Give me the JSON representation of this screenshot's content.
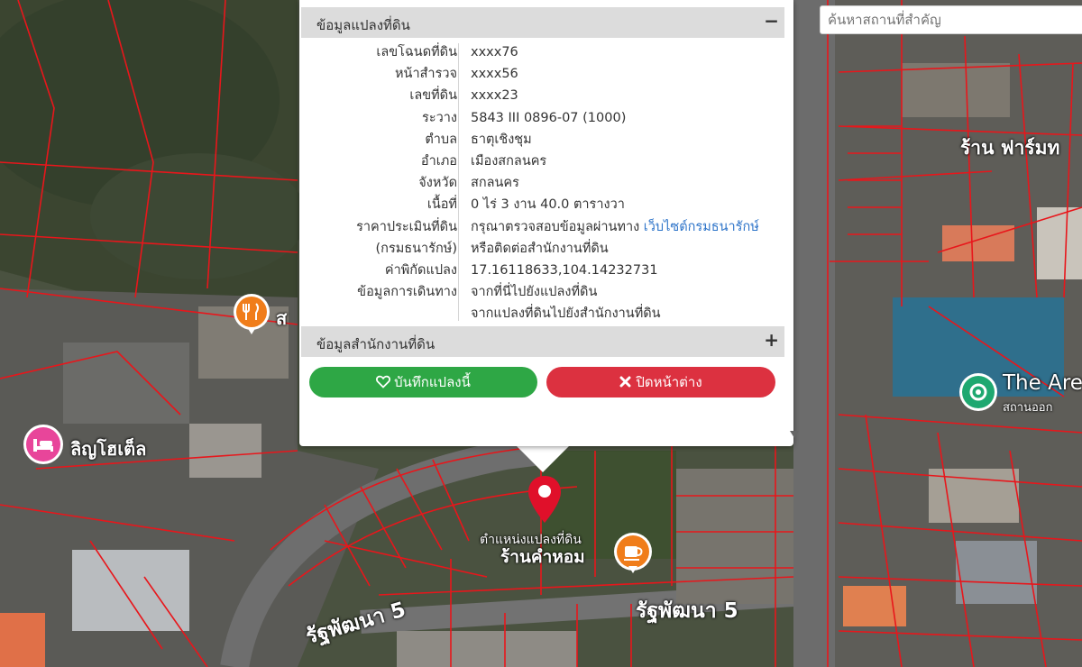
{
  "search": {
    "placeholder": "ค้นหาสถานที่สำคัญ"
  },
  "popup": {
    "parcel_section_title": "ข้อมูลแปลงที่ดิน",
    "parcel_toggle": "−",
    "rows": [
      {
        "label": "เลขโฉนดที่ดิน",
        "value": "xxxx76"
      },
      {
        "label": "หน้าสำรวจ",
        "value": "xxxx56"
      },
      {
        "label": "เลขที่ดิน",
        "value": "xxxx23"
      },
      {
        "label": "ระวาง",
        "value": "5843 III 0896-07 (1000)"
      },
      {
        "label": "ตำบล",
        "value": "ธาตุเชิงชุม"
      },
      {
        "label": "อำเภอ",
        "value": "เมืองสกลนคร"
      },
      {
        "label": "จังหวัด",
        "value": "สกลนคร"
      },
      {
        "label": "เนื้อที่",
        "value": "0 ไร่ 3 งาน 40.0 ตารางวา"
      }
    ],
    "price_label_1": "ราคาประเมินที่ดิน",
    "price_label_2": "(กรมธนารักษ์)",
    "price_text": "กรุณาตรวจสอบข้อมูลผ่านทาง",
    "price_link": "เว็บไซต์กรมธนารักษ์",
    "price_text_2": "หรือติดต่อสำนักงานที่ดิน",
    "coord_label": "ค่าพิกัดแปลง",
    "coord_value": "17.16118633,104.14232731",
    "travel_label": "ข้อมูลการเดินทาง",
    "travel_link_1": "จากที่นี่ไปยังแปลงที่ดิน",
    "travel_link_2": "จากแปลงที่ดินไปยังสำนักงานที่ดิน",
    "office_section_title": "ข้อมูลสำนักงานที่ดิน",
    "office_toggle": "+",
    "save_button": "บันทึกแปลงนี้",
    "close_button": "ปิดหน้าต่าง"
  },
  "map_labels": {
    "pin_label": "ตำแหน่งแปลงที่ดิน",
    "cafe": "ร้านคำหอม",
    "hotel": "ลิญโฮเต็ล",
    "road_right": "รัฐพัฒนา 5",
    "road_left": "รัฐพัฒนา 5",
    "shop_right": "ร้าน ฟาร์มท",
    "the_area": "The Are",
    "the_area_sub": "สถานออก",
    "restaurant_partial": "ส"
  },
  "colors": {
    "parcel_line": "#e8161b",
    "save_green": "#2ea745",
    "close_red": "#dc3140",
    "link_blue": "#2e74c9",
    "pin_red": "#e0102a",
    "poi_orange": "#f07d1a",
    "poi_pink": "#e8459a",
    "poi_green": "#1ea870"
  },
  "icons": [
    "heart-icon",
    "close-icon",
    "map-pin-icon",
    "restaurant-icon",
    "hotel-icon",
    "cafe-icon",
    "landmark-icon"
  ]
}
